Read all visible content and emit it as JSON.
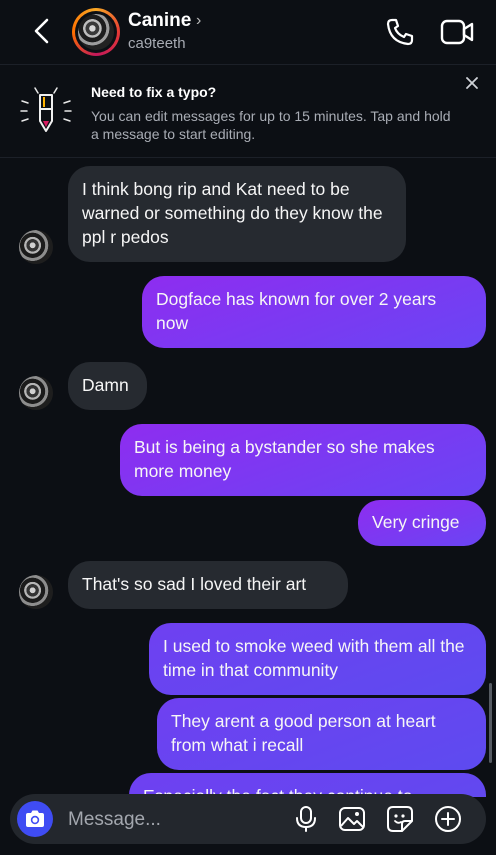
{
  "header": {
    "name": "Canine",
    "username": "ca9teeth"
  },
  "banner": {
    "title": "Need to fix a typo?",
    "text": "You can edit messages for up to 15 minutes. Tap and hold a message to start editing."
  },
  "messages": [
    {
      "side": "in",
      "text": "I think bong rip and Kat need to be warned or something do they know the ppl r pedos"
    },
    {
      "side": "out",
      "text": "Dogface has known for over 2 years now"
    },
    {
      "side": "in",
      "text": "Damn"
    },
    {
      "side": "out",
      "text": "But is being a bystander so she makes more money"
    },
    {
      "side": "out",
      "text": "Very cringe"
    },
    {
      "side": "in",
      "text": "That's so sad I loved their art"
    },
    {
      "side": "out",
      "text": "I used to smoke weed with them all the time in that community"
    },
    {
      "side": "out",
      "text": "They arent a good person at heart from what i recall"
    },
    {
      "side": "out",
      "text": "Especially the fact they continue to"
    }
  ],
  "composer": {
    "placeholder": "Message..."
  },
  "colors": {
    "background": "#0c0f14",
    "incoming_bubble": "#262a30",
    "outgoing_bubble_top": "#8e2df0",
    "outgoing_bubble_bottom": "#5d4bf0",
    "camera_button": "#3f4cf3"
  }
}
